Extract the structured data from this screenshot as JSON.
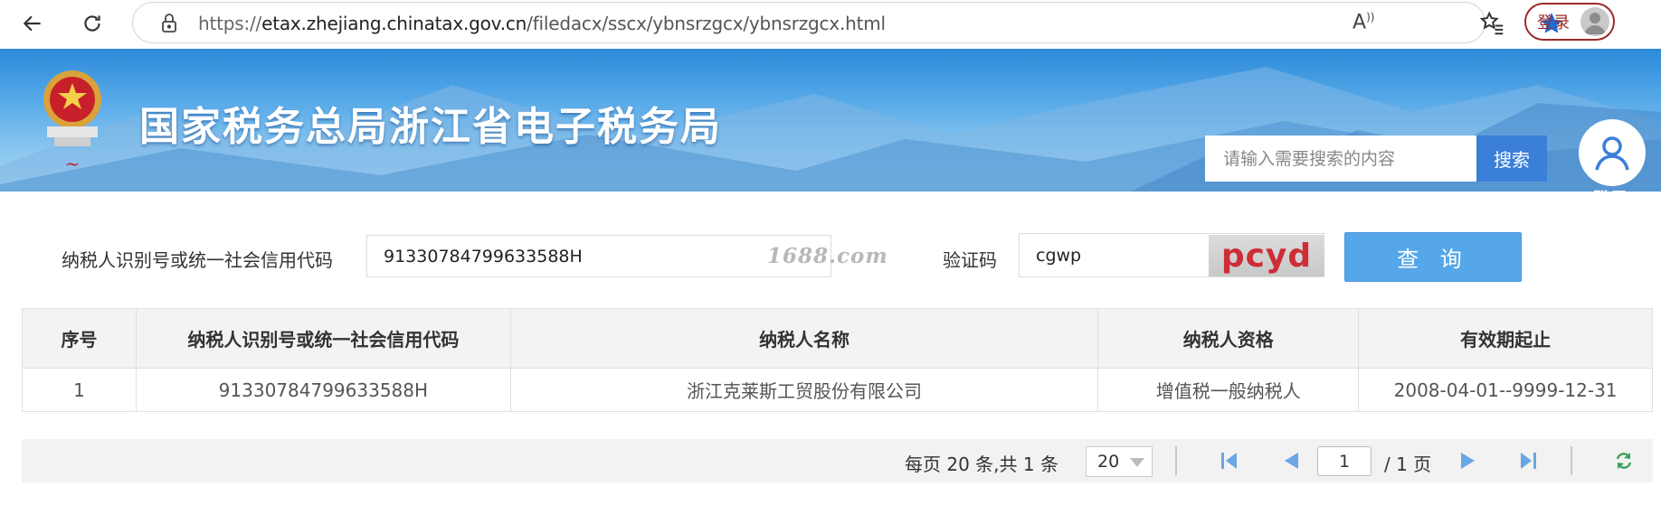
{
  "browser": {
    "url_scheme": "https://",
    "url_host": "etax.zhejiang.chinatax.gov.cn",
    "url_path": "/filedacx/sscx/ybnsrzgcx/ybnsrzgcx.html",
    "read_aloud": "Â",
    "login_label": "登录"
  },
  "banner": {
    "title": "国家税务总局浙江省电子税务局",
    "search_placeholder": "请输入需要搜索的内容",
    "search_button": "搜索",
    "user_label": "登录"
  },
  "form": {
    "taxid_label": "纳税人识别号或统一社会信用代码",
    "taxid_value": "91330784799633588H",
    "watermark": "1688.com",
    "captcha_label": "验证码",
    "captcha_value": "cgwp",
    "captcha_image_text": "pcyd",
    "query_button": "查 询"
  },
  "table": {
    "headers": [
      "序号",
      "纳税人识别号或统一社会信用代码",
      "纳税人名称",
      "纳税人资格",
      "有效期起止"
    ],
    "rows": [
      [
        "1",
        "91330784799633588H",
        "浙江克莱斯工贸股份有限公司",
        "增值税一般纳税人",
        "2008-04-01--9999-12-31"
      ]
    ]
  },
  "pagination": {
    "info": "每页 20 条,共 1 条",
    "page_size": "20",
    "current_page": "1",
    "total_pages": "/ 1 页"
  },
  "colors": {
    "accent_blue": "#3a7fd8",
    "query_button": "#56a6ea",
    "captcha_text": "#cc2d36",
    "login_border": "#9b2a2a"
  }
}
